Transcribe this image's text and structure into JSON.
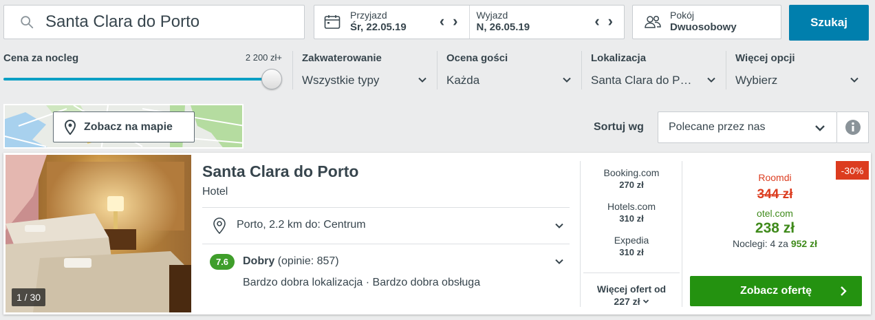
{
  "search": {
    "destination": "Santa Clara do Porto",
    "checkin_label": "Przyjazd",
    "checkin_value": "Śr, 22.05.19",
    "checkout_label": "Wyjazd",
    "checkout_value": "N, 26.05.19",
    "rooms_label": "Pokój",
    "rooms_value": "Dwuosobowy",
    "search_button": "Szukaj"
  },
  "filters": {
    "price_label": "Cena za nocleg",
    "price_max": "2 200 zł+",
    "price_slider_level": 1.0,
    "groups": [
      {
        "title": "Zakwaterowanie",
        "value": "Wszystkie typy"
      },
      {
        "title": "Ocena gości",
        "value": "Każda"
      },
      {
        "title": "Lokalizacja",
        "value": "Santa Clara do P…"
      },
      {
        "title": "Więcej opcji",
        "value": "Wybierz"
      }
    ]
  },
  "map": {
    "button_label": "Zobacz na mapie"
  },
  "sort": {
    "label": "Sortuj wg",
    "value": "Polecane przez nas"
  },
  "result": {
    "name": "Santa Clara do Porto",
    "type": "Hotel",
    "photo_counter": "1 / 30",
    "location": "Porto, 2.2 km do: Centrum",
    "rating_score": "7.6",
    "rating_word": "Dobry",
    "rating_reviews": "(opinie: 857)",
    "rating_highlights": "Bardzo dobra lokalizacja · Bardzo dobra obsługa",
    "other_deals": [
      {
        "provider": "Booking.com",
        "price": "270 zł"
      },
      {
        "provider": "Hotels.com",
        "price": "310 zł"
      },
      {
        "provider": "Expedia",
        "price": "310 zł"
      }
    ],
    "more_offers_label": "Więcej ofert od",
    "more_offers_price": "227 zł",
    "discount": "-30%",
    "old_provider": "Roomdi",
    "old_price": "344 zł",
    "best_provider": "otel.com",
    "best_price": "238 zł",
    "nights_text": "Noclegi: 4 za",
    "nights_total": "952 zł",
    "cta_label": "Zobacz ofertę"
  },
  "colors": {
    "primary_blue": "#007fad",
    "slider": "#0a9fc4",
    "green": "#249210",
    "rating_green": "#3f9e2b",
    "discount_red": "#dc3c1f"
  }
}
